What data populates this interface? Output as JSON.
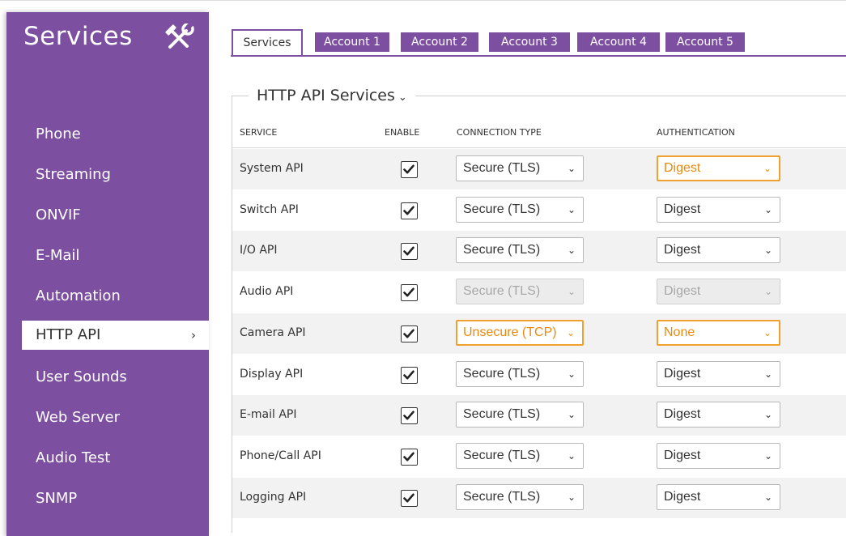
{
  "sidebar": {
    "title": "Services",
    "items": [
      {
        "label": "Phone"
      },
      {
        "label": "Streaming"
      },
      {
        "label": "ONVIF"
      },
      {
        "label": "E-Mail"
      },
      {
        "label": "Automation"
      },
      {
        "label": "HTTP API",
        "active": true
      },
      {
        "label": "User Sounds"
      },
      {
        "label": "Web Server"
      },
      {
        "label": "Audio Test"
      },
      {
        "label": "SNMP"
      }
    ],
    "active_chevron": "›"
  },
  "tabs": [
    {
      "label": "Services",
      "active": true
    },
    {
      "label": "Account 1"
    },
    {
      "label": "Account 2"
    },
    {
      "label": "Account 3"
    },
    {
      "label": "Account 4"
    },
    {
      "label": "Account 5"
    }
  ],
  "section": {
    "title": "HTTP API Services",
    "caret": "⌄",
    "columns": {
      "service": "SERVICE",
      "enable": "ENABLE",
      "connection_type": "CONNECTION TYPE",
      "authentication": "AUTHENTICATION"
    }
  },
  "rows": [
    {
      "service": "System API",
      "enabled": true,
      "connection": "Secure (TLS)",
      "auth": "Digest",
      "auth_highlight": true
    },
    {
      "service": "Switch API",
      "enabled": true,
      "connection": "Secure (TLS)",
      "auth": "Digest"
    },
    {
      "service": "I/O API",
      "enabled": true,
      "connection": "Secure (TLS)",
      "auth": "Digest"
    },
    {
      "service": "Audio API",
      "enabled": true,
      "connection": "Secure (TLS)",
      "auth": "Digest",
      "disabled": true
    },
    {
      "service": "Camera API",
      "enabled": true,
      "connection": "Unsecure (TCP)",
      "auth": "None",
      "conn_highlight": true,
      "auth_highlight": true
    },
    {
      "service": "Display API",
      "enabled": true,
      "connection": "Secure (TLS)",
      "auth": "Digest"
    },
    {
      "service": "E-mail API",
      "enabled": true,
      "connection": "Secure (TLS)",
      "auth": "Digest"
    },
    {
      "service": "Phone/Call API",
      "enabled": true,
      "connection": "Secure (TLS)",
      "auth": "Digest"
    },
    {
      "service": "Logging API",
      "enabled": true,
      "connection": "Secure (TLS)",
      "auth": "Digest"
    }
  ],
  "select_arrow": "⌄",
  "colors": {
    "brand_purple": "#7d4fa0",
    "highlight_orange": "#f0a030"
  },
  "icons": {
    "sidebar_title_icon": "tools-icon",
    "checkbox_mark": "checkmark-icon"
  }
}
